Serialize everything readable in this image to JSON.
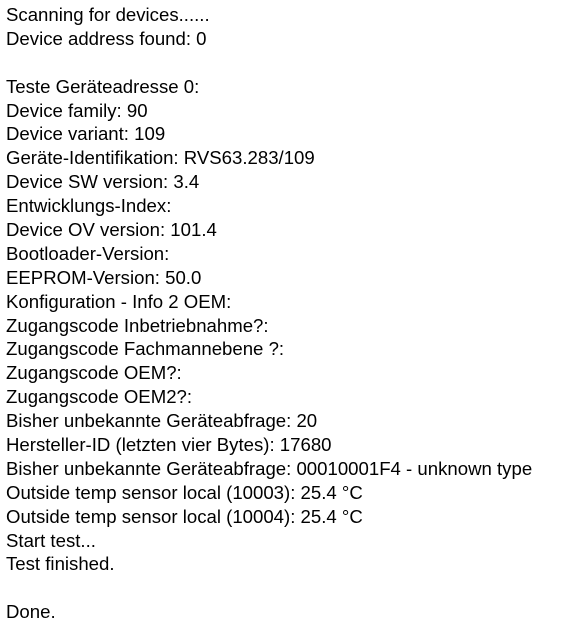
{
  "output": {
    "lines": [
      "Scanning for devices......",
      "Device address found: 0",
      "",
      "Teste Geräteadresse 0:",
      "Device family: 90",
      "Device variant: 109",
      "Geräte-Identifikation: RVS63.283/109",
      "Device SW version: 3.4",
      "Entwicklungs-Index:",
      "Device OV version: 101.4",
      "Bootloader-Version:",
      "EEPROM-Version: 50.0",
      "Konfiguration - Info 2 OEM:",
      "Zugangscode Inbetriebnahme?:",
      "Zugangscode Fachmannebene ?:",
      "Zugangscode OEM?:",
      "Zugangscode OEM2?:",
      "Bisher unbekannte Geräteabfrage: 20",
      "Hersteller-ID (letzten vier Bytes): 17680",
      "Bisher unbekannte Geräteabfrage: 00010001F4 - unknown type",
      "Outside temp sensor local (10003): 25.4 °C",
      "Outside temp sensor local (10004): 25.4 °C",
      "Start test...",
      "Test finished.",
      "",
      "Done."
    ]
  }
}
